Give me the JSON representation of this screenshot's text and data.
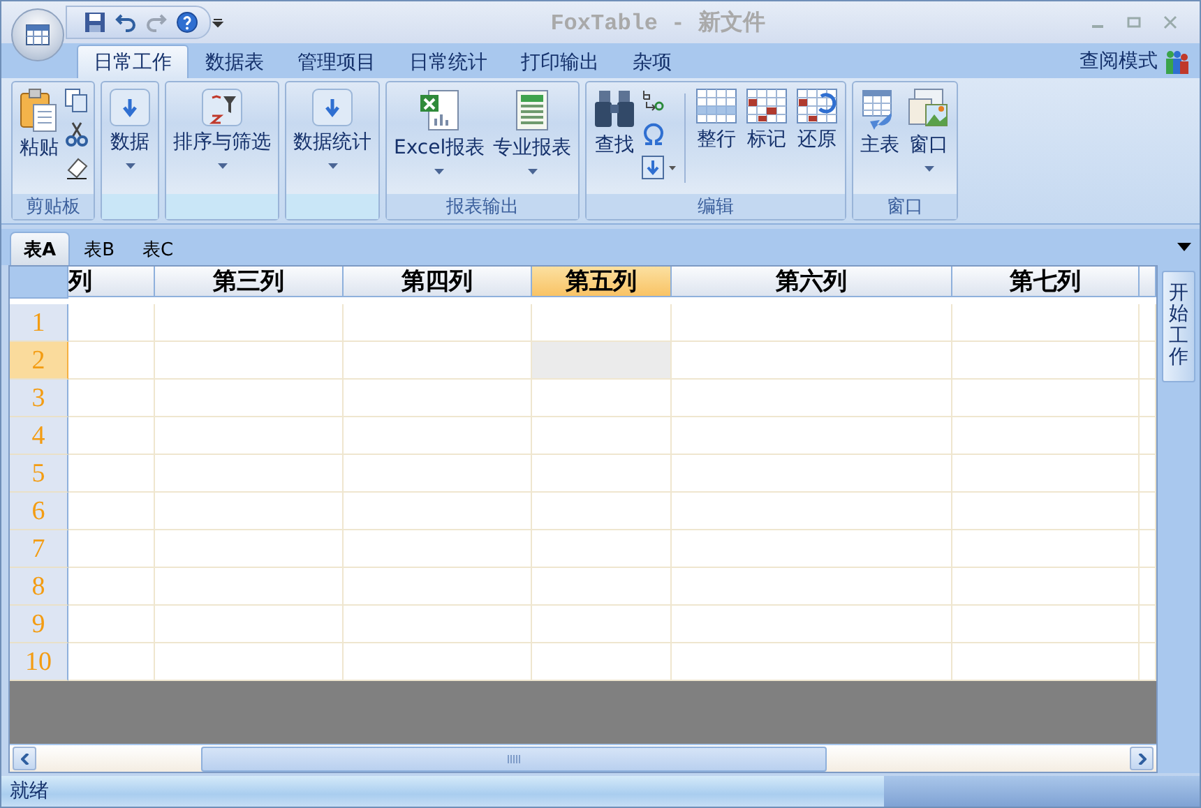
{
  "window": {
    "title": "FoxTable - 新文件"
  },
  "ribbon_tabs": [
    {
      "label": "日常工作",
      "selected": true
    },
    {
      "label": "数据表",
      "selected": false
    },
    {
      "label": "管理项目",
      "selected": false
    },
    {
      "label": "日常统计",
      "selected": false
    },
    {
      "label": "打印输出",
      "selected": false
    },
    {
      "label": "杂项",
      "selected": false
    }
  ],
  "ribbon_mode": "查阅模式",
  "ribbon_groups": [
    {
      "label": "剪贴板",
      "buttons": [
        {
          "label": "粘贴",
          "dropdown": false
        }
      ],
      "small_tools": true
    },
    {
      "buttons": [
        {
          "label": "数据",
          "dropdown": true
        }
      ],
      "small_tools": false
    },
    {
      "buttons": [
        {
          "label": "排序与筛选",
          "dropdown": true
        }
      ],
      "small_tools": false
    },
    {
      "buttons": [
        {
          "label": "数据统计",
          "dropdown": true
        }
      ],
      "small_tools": false
    },
    {
      "label": "报表输出",
      "buttons": [
        {
          "label": "Excel报表",
          "dropdown": true
        },
        {
          "label": "专业报表",
          "dropdown": true
        }
      ],
      "small_tools": false
    },
    {
      "label": "编辑",
      "buttons": [
        {
          "label": "查找",
          "dropdown": false
        },
        {
          "label": "整行",
          "dropdown": false
        },
        {
          "label": "标记",
          "dropdown": false
        },
        {
          "label": "还原",
          "dropdown": false
        }
      ],
      "small_tools": true
    },
    {
      "label": "窗口",
      "buttons": [
        {
          "label": "主表",
          "dropdown": false
        },
        {
          "label": "窗口",
          "dropdown": true
        }
      ],
      "small_tools": false
    }
  ],
  "sheet_tabs": [
    {
      "label": "表A",
      "selected": true
    },
    {
      "label": "表B",
      "selected": false
    },
    {
      "label": "表C",
      "selected": false
    }
  ],
  "table": {
    "columns": [
      {
        "label": "列",
        "selected": false
      },
      {
        "label": "第三列",
        "selected": false
      },
      {
        "label": "第四列",
        "selected": false
      },
      {
        "label": "第五列",
        "selected": true
      },
      {
        "label": "第六列",
        "selected": false
      },
      {
        "label": "第七列",
        "selected": false
      }
    ],
    "rows": [
      {
        "label": "1",
        "selected": false
      },
      {
        "label": "2",
        "selected": true
      },
      {
        "label": "3",
        "selected": false
      },
      {
        "label": "4",
        "selected": false
      },
      {
        "label": "5",
        "selected": false
      },
      {
        "label": "6",
        "selected": false
      },
      {
        "label": "7",
        "selected": false
      },
      {
        "label": "8",
        "selected": false
      },
      {
        "label": "9",
        "selected": false
      },
      {
        "label": "10",
        "selected": false
      }
    ]
  },
  "side_panel": {
    "button": "开始工作"
  },
  "status_bar": {
    "text": "就绪"
  }
}
